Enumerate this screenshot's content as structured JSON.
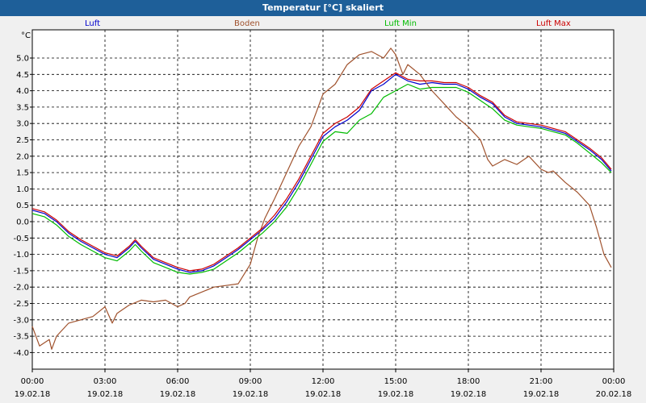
{
  "window": {
    "title": "Temperatur [°C] skaliert"
  },
  "chart_data": {
    "type": "line",
    "title": "Temperatur [°C] skaliert",
    "ylabel": "°C",
    "xlabel": "",
    "ylim": [
      -4.0,
      5.5
    ],
    "xlim_hours": [
      0,
      24
    ],
    "grid": true,
    "grid_style": "dashed",
    "legend_position": "top",
    "y_ticks": [
      "5.0",
      "4.5",
      "4.0",
      "3.5",
      "3.0",
      "2.5",
      "2.0",
      "1.5",
      "1.0",
      "0.5",
      "0.0",
      "-0.5",
      "-1.0",
      "-1.5",
      "-2.0",
      "-2.5",
      "-3.0",
      "-3.5",
      "-4.0"
    ],
    "x_ticks": [
      {
        "time": "00:00",
        "date": "19.02.18"
      },
      {
        "time": "03:00",
        "date": "19.02.18"
      },
      {
        "time": "06:00",
        "date": "19.02.18"
      },
      {
        "time": "09:00",
        "date": "19.02.18"
      },
      {
        "time": "12:00",
        "date": "19.02.18"
      },
      {
        "time": "15:00",
        "date": "19.02.18"
      },
      {
        "time": "18:00",
        "date": "19.02.18"
      },
      {
        "time": "21:00",
        "date": "19.02.18"
      },
      {
        "time": "00:00",
        "date": "20.02.18"
      }
    ],
    "series": [
      {
        "name": "Luft",
        "color": "#0000cc",
        "points": [
          [
            0,
            0.35
          ],
          [
            0.5,
            0.25
          ],
          [
            1,
            0.0
          ],
          [
            1.5,
            -0.35
          ],
          [
            2,
            -0.6
          ],
          [
            2.5,
            -0.8
          ],
          [
            3,
            -1.0
          ],
          [
            3.5,
            -1.1
          ],
          [
            4,
            -0.8
          ],
          [
            4.25,
            -0.6
          ],
          [
            4.5,
            -0.8
          ],
          [
            5,
            -1.15
          ],
          [
            5.5,
            -1.3
          ],
          [
            6,
            -1.45
          ],
          [
            6.5,
            -1.55
          ],
          [
            7,
            -1.5
          ],
          [
            7.5,
            -1.35
          ],
          [
            8,
            -1.1
          ],
          [
            8.5,
            -0.85
          ],
          [
            9,
            -0.55
          ],
          [
            9.5,
            -0.25
          ],
          [
            10,
            0.1
          ],
          [
            10.5,
            0.6
          ],
          [
            11,
            1.2
          ],
          [
            11.5,
            1.9
          ],
          [
            12,
            2.6
          ],
          [
            12.5,
            2.9
          ],
          [
            13,
            3.1
          ],
          [
            13.5,
            3.4
          ],
          [
            14,
            4.0
          ],
          [
            14.5,
            4.2
          ],
          [
            15,
            4.5
          ],
          [
            15.5,
            4.3
          ],
          [
            16,
            4.2
          ],
          [
            16.5,
            4.25
          ],
          [
            17,
            4.2
          ],
          [
            17.5,
            4.2
          ],
          [
            18,
            4.05
          ],
          [
            18.5,
            3.8
          ],
          [
            19,
            3.6
          ],
          [
            19.5,
            3.2
          ],
          [
            20,
            3.0
          ],
          [
            20.5,
            2.95
          ],
          [
            21,
            2.9
          ],
          [
            21.5,
            2.8
          ],
          [
            22,
            2.7
          ],
          [
            22.5,
            2.45
          ],
          [
            23,
            2.2
          ],
          [
            23.5,
            1.9
          ],
          [
            23.9,
            1.55
          ]
        ]
      },
      {
        "name": "Boden",
        "color": "#a0522d",
        "points": [
          [
            0,
            -3.2
          ],
          [
            0.3,
            -3.8
          ],
          [
            0.7,
            -3.6
          ],
          [
            0.8,
            -3.9
          ],
          [
            1,
            -3.5
          ],
          [
            1.5,
            -3.1
          ],
          [
            2,
            -3.0
          ],
          [
            2.5,
            -2.9
          ],
          [
            3,
            -2.6
          ],
          [
            3.3,
            -3.1
          ],
          [
            3.5,
            -2.8
          ],
          [
            4,
            -2.55
          ],
          [
            4.5,
            -2.4
          ],
          [
            5,
            -2.45
          ],
          [
            5.5,
            -2.4
          ],
          [
            6,
            -2.6
          ],
          [
            6.3,
            -2.5
          ],
          [
            6.5,
            -2.3
          ],
          [
            7,
            -2.15
          ],
          [
            7.5,
            -2.0
          ],
          [
            8,
            -1.95
          ],
          [
            8.5,
            -1.9
          ],
          [
            9,
            -1.3
          ],
          [
            9.3,
            -0.5
          ],
          [
            9.6,
            0.1
          ],
          [
            10,
            0.7
          ],
          [
            10.5,
            1.5
          ],
          [
            11,
            2.3
          ],
          [
            11.5,
            2.9
          ],
          [
            12,
            3.9
          ],
          [
            12.5,
            4.2
          ],
          [
            13,
            4.8
          ],
          [
            13.5,
            5.1
          ],
          [
            14,
            5.2
          ],
          [
            14.5,
            5.0
          ],
          [
            14.8,
            5.3
          ],
          [
            15,
            5.1
          ],
          [
            15.3,
            4.5
          ],
          [
            15.5,
            4.8
          ],
          [
            16,
            4.5
          ],
          [
            16.5,
            4.0
          ],
          [
            17,
            3.6
          ],
          [
            17.5,
            3.2
          ],
          [
            18,
            2.9
          ],
          [
            18.5,
            2.5
          ],
          [
            18.8,
            1.9
          ],
          [
            19,
            1.7
          ],
          [
            19.5,
            1.9
          ],
          [
            20,
            1.75
          ],
          [
            20.5,
            2.0
          ],
          [
            21,
            1.6
          ],
          [
            21.3,
            1.5
          ],
          [
            21.5,
            1.55
          ],
          [
            22,
            1.2
          ],
          [
            22.5,
            0.9
          ],
          [
            23,
            0.5
          ],
          [
            23.3,
            -0.2
          ],
          [
            23.6,
            -1.0
          ],
          [
            23.9,
            -1.4
          ]
        ]
      },
      {
        "name": "Luft Min",
        "color": "#00bb00",
        "points": [
          [
            0,
            0.25
          ],
          [
            0.5,
            0.15
          ],
          [
            1,
            -0.1
          ],
          [
            1.5,
            -0.45
          ],
          [
            2,
            -0.7
          ],
          [
            2.5,
            -0.9
          ],
          [
            3,
            -1.1
          ],
          [
            3.5,
            -1.2
          ],
          [
            4,
            -0.9
          ],
          [
            4.25,
            -0.7
          ],
          [
            4.5,
            -0.9
          ],
          [
            5,
            -1.25
          ],
          [
            5.5,
            -1.4
          ],
          [
            6,
            -1.55
          ],
          [
            6.5,
            -1.6
          ],
          [
            7,
            -1.55
          ],
          [
            7.5,
            -1.45
          ],
          [
            8,
            -1.2
          ],
          [
            8.5,
            -0.95
          ],
          [
            9,
            -0.65
          ],
          [
            9.5,
            -0.35
          ],
          [
            10,
            0.0
          ],
          [
            10.5,
            0.45
          ],
          [
            11,
            1.05
          ],
          [
            11.5,
            1.75
          ],
          [
            12,
            2.45
          ],
          [
            12.5,
            2.75
          ],
          [
            13,
            2.7
          ],
          [
            13.5,
            3.1
          ],
          [
            14,
            3.3
          ],
          [
            14.5,
            3.8
          ],
          [
            15,
            4.0
          ],
          [
            15.5,
            4.2
          ],
          [
            16,
            4.05
          ],
          [
            16.5,
            4.1
          ],
          [
            17,
            4.1
          ],
          [
            17.5,
            4.1
          ],
          [
            18,
            3.95
          ],
          [
            18.5,
            3.7
          ],
          [
            19,
            3.45
          ],
          [
            19.5,
            3.1
          ],
          [
            20,
            2.95
          ],
          [
            20.5,
            2.9
          ],
          [
            21,
            2.85
          ],
          [
            21.5,
            2.75
          ],
          [
            22,
            2.65
          ],
          [
            22.5,
            2.4
          ],
          [
            23,
            2.1
          ],
          [
            23.5,
            1.8
          ],
          [
            23.9,
            1.5
          ]
        ]
      },
      {
        "name": "Luft Max",
        "color": "#cc0000",
        "points": [
          [
            0,
            0.4
          ],
          [
            0.5,
            0.3
          ],
          [
            1,
            0.05
          ],
          [
            1.5,
            -0.3
          ],
          [
            2,
            -0.55
          ],
          [
            2.5,
            -0.75
          ],
          [
            3,
            -0.95
          ],
          [
            3.5,
            -1.05
          ],
          [
            4,
            -0.75
          ],
          [
            4.25,
            -0.55
          ],
          [
            4.5,
            -0.75
          ],
          [
            5,
            -1.1
          ],
          [
            5.5,
            -1.25
          ],
          [
            6,
            -1.4
          ],
          [
            6.5,
            -1.5
          ],
          [
            7,
            -1.45
          ],
          [
            7.5,
            -1.3
          ],
          [
            8,
            -1.05
          ],
          [
            8.5,
            -0.8
          ],
          [
            9,
            -0.5
          ],
          [
            9.5,
            -0.2
          ],
          [
            10,
            0.2
          ],
          [
            10.5,
            0.7
          ],
          [
            11,
            1.3
          ],
          [
            11.5,
            2.0
          ],
          [
            12,
            2.7
          ],
          [
            12.5,
            3.0
          ],
          [
            13,
            3.2
          ],
          [
            13.5,
            3.5
          ],
          [
            14,
            4.05
          ],
          [
            14.5,
            4.3
          ],
          [
            15,
            4.55
          ],
          [
            15.5,
            4.35
          ],
          [
            16,
            4.3
          ],
          [
            16.5,
            4.3
          ],
          [
            17,
            4.25
          ],
          [
            17.5,
            4.25
          ],
          [
            18,
            4.1
          ],
          [
            18.5,
            3.85
          ],
          [
            19,
            3.65
          ],
          [
            19.5,
            3.25
          ],
          [
            20,
            3.05
          ],
          [
            20.5,
            3.0
          ],
          [
            21,
            2.95
          ],
          [
            21.5,
            2.85
          ],
          [
            22,
            2.75
          ],
          [
            22.5,
            2.5
          ],
          [
            23,
            2.25
          ],
          [
            23.5,
            1.95
          ],
          [
            23.9,
            1.6
          ]
        ]
      }
    ]
  }
}
